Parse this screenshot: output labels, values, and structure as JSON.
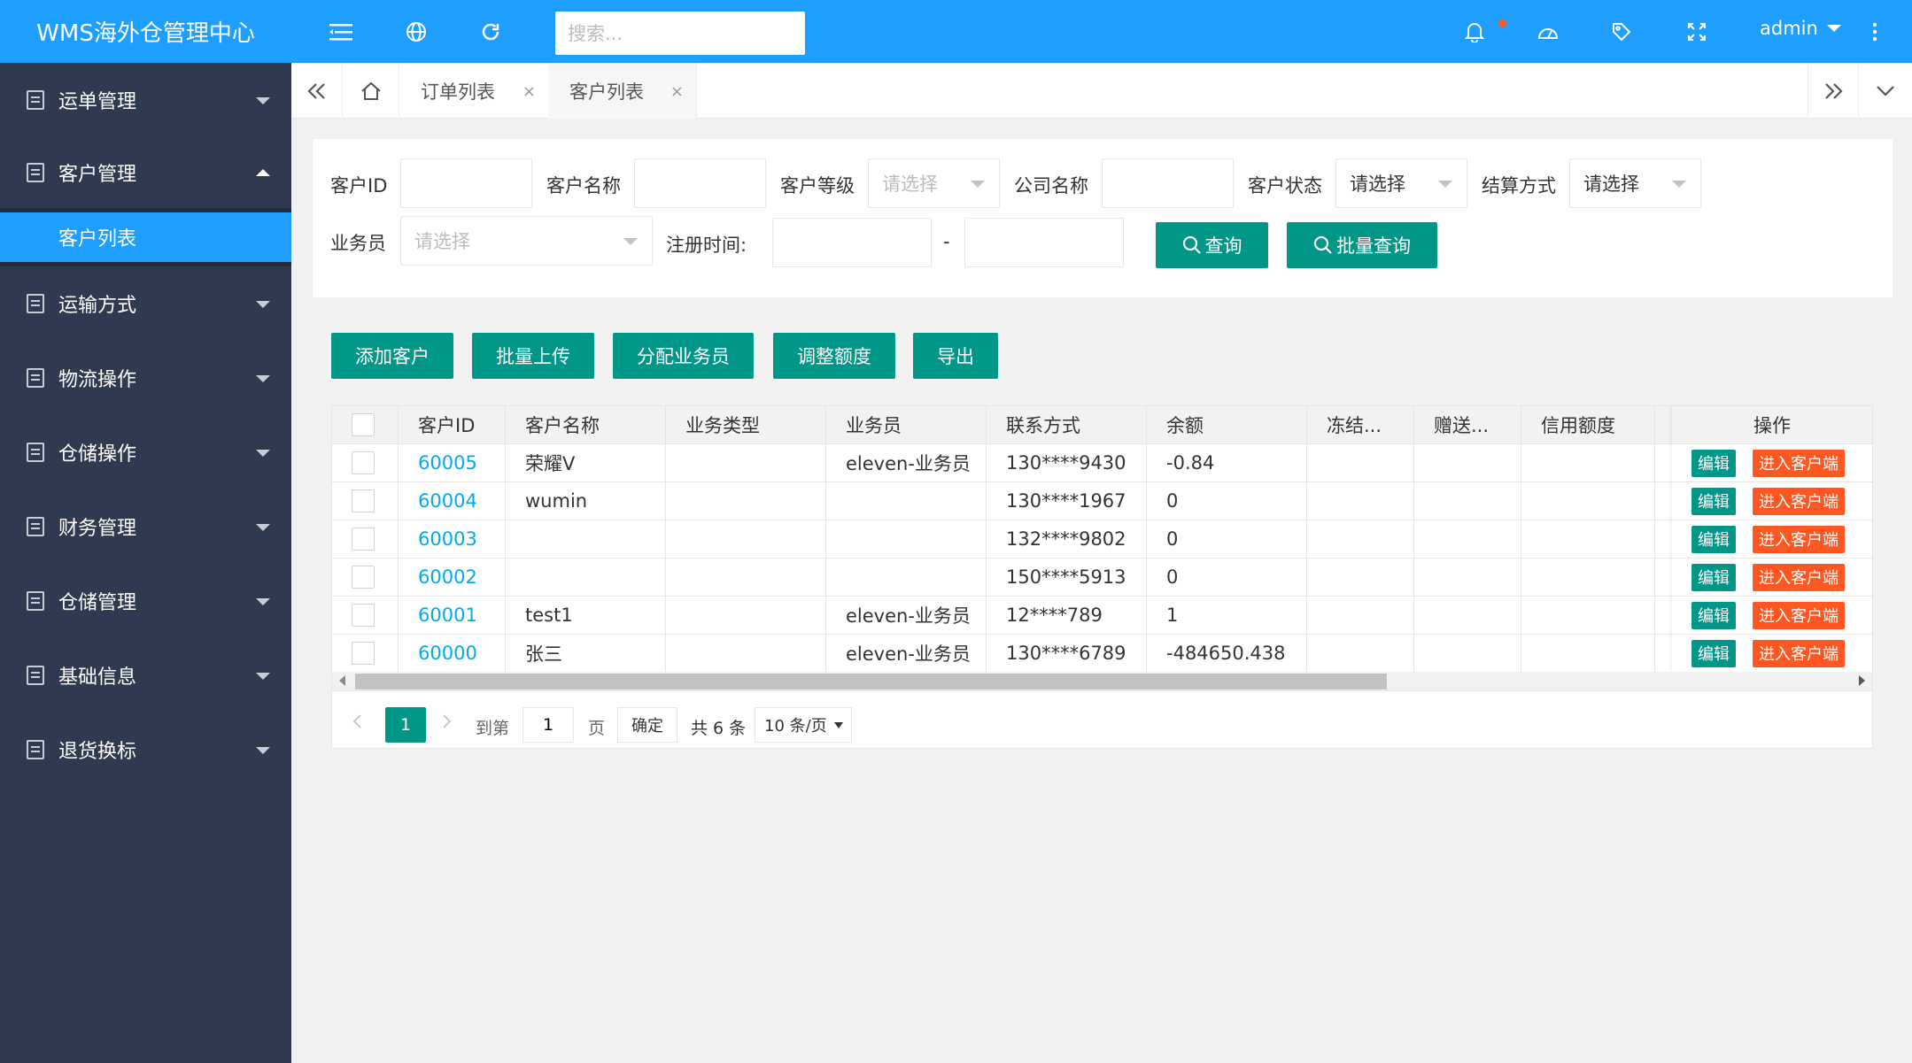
{
  "app": {
    "title": "WMS海外仓管理中心"
  },
  "topbar": {
    "search_placeholder": "搜索...",
    "user": "admin"
  },
  "sidebar": {
    "items": [
      {
        "label": "运单管理"
      },
      {
        "label": "客户管理"
      },
      {
        "label": "运输方式"
      },
      {
        "label": "物流操作"
      },
      {
        "label": "仓储操作"
      },
      {
        "label": "财务管理"
      },
      {
        "label": "仓储管理"
      },
      {
        "label": "基础信息"
      },
      {
        "label": "退货换标"
      }
    ],
    "submenu_active": "客户列表"
  },
  "tabs": [
    {
      "label": "订单列表",
      "close": "×"
    },
    {
      "label": "客户列表",
      "close": "×"
    }
  ],
  "filter": {
    "customer_id_label": "客户ID",
    "customer_name_label": "客户名称",
    "customer_level_label": "客户等级",
    "customer_level_placeholder": "请选择",
    "company_name_label": "公司名称",
    "customer_status_label": "客户状态",
    "customer_status_value": "请选择",
    "settlement_label": "结算方式",
    "settlement_value": "请选择",
    "salesman_label": "业务员",
    "salesman_placeholder": "请选择",
    "register_time_label": "注册时间:",
    "range_sep": "-",
    "query_button": "查询",
    "batch_query_button": "批量查询"
  },
  "actions": {
    "add_customer": "添加客户",
    "batch_upload": "批量上传",
    "assign_salesman": "分配业务员",
    "adjust_quota": "调整额度",
    "export": "导出"
  },
  "table": {
    "headers": {
      "customer_id": "客户ID",
      "customer_name": "客户名称",
      "business_type": "业务类型",
      "salesman": "业务员",
      "contact": "联系方式",
      "balance": "余额",
      "frozen": "冻结...",
      "gift": "赠送...",
      "credit": "信用额度",
      "operation": "操作"
    },
    "rows": [
      {
        "id": "60005",
        "name": "荣耀V",
        "type": "",
        "salesman": "eleven-业务员",
        "contact": "130****9430",
        "balance": "-0.84",
        "frozen": "",
        "gift": "",
        "credit": ""
      },
      {
        "id": "60004",
        "name": "wumin",
        "type": "",
        "salesman": "",
        "contact": "130****1967",
        "balance": "0",
        "frozen": "",
        "gift": "",
        "credit": ""
      },
      {
        "id": "60003",
        "name": "",
        "type": "",
        "salesman": "",
        "contact": "132****9802",
        "balance": "0",
        "frozen": "",
        "gift": "",
        "credit": ""
      },
      {
        "id": "60002",
        "name": "",
        "type": "",
        "salesman": "",
        "contact": "150****5913",
        "balance": "0",
        "frozen": "",
        "gift": "",
        "credit": ""
      },
      {
        "id": "60001",
        "name": "test1",
        "type": "",
        "salesman": "eleven-业务员",
        "contact": "12****789",
        "balance": "1",
        "frozen": "",
        "gift": "",
        "credit": ""
      },
      {
        "id": "60000",
        "name": "张三",
        "type": "",
        "salesman": "eleven-业务员",
        "contact": "130****6789",
        "balance": "-484650.438",
        "frozen": "",
        "gift": "",
        "credit": ""
      }
    ],
    "edit_label": "编辑",
    "enter_label": "进入客户端"
  },
  "pager": {
    "current_page": "1",
    "goto_label": "到第",
    "goto_value": "1",
    "page_unit": "页",
    "confirm": "确定",
    "total": "共 6 条",
    "page_size": "10 条/页"
  },
  "colors": {
    "topbar": "#1e9fff",
    "sidebar": "#2f3a50",
    "primary_button": "#009688",
    "danger_button": "#ff5722",
    "link": "#01aaed"
  }
}
